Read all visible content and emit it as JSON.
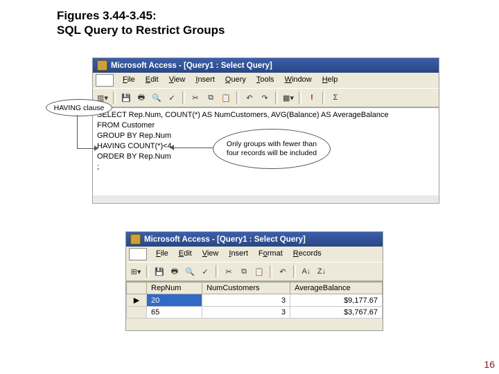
{
  "slide": {
    "title_line1": "Figures 3.44-3.45:",
    "title_line2": "SQL Query to Restrict Groups",
    "page_number": "16"
  },
  "access1": {
    "title": "Microsoft Access - [Query1 : Select Query]",
    "menus": [
      "File",
      "Edit",
      "View",
      "Insert",
      "Query",
      "Tools",
      "Window",
      "Help"
    ],
    "sql_lines": [
      "SELECT Rep.Num, COUNT(*) AS NumCustomers, AVG(Balance) AS AverageBalance",
      "FROM Customer",
      "GROUP BY Rep.Num",
      "HAVING COUNT(*)<4",
      "ORDER BY Rep.Num",
      ";"
    ]
  },
  "callouts": {
    "having": "HAVING clause",
    "groups": "Only groups with fewer than four records will be included"
  },
  "access2": {
    "title": "Microsoft Access - [Query1 : Select Query]",
    "menus": [
      "File",
      "Edit",
      "View",
      "Insert",
      "Format",
      "Records"
    ],
    "columns": [
      "RepNum",
      "NumCustomers",
      "AverageBalance"
    ],
    "rows": [
      {
        "repnum": "20",
        "numcustomers": "3",
        "avg": "$9,177.67",
        "selected": true
      },
      {
        "repnum": "65",
        "numcustomers": "3",
        "avg": "$3,767.67",
        "selected": false
      }
    ]
  }
}
